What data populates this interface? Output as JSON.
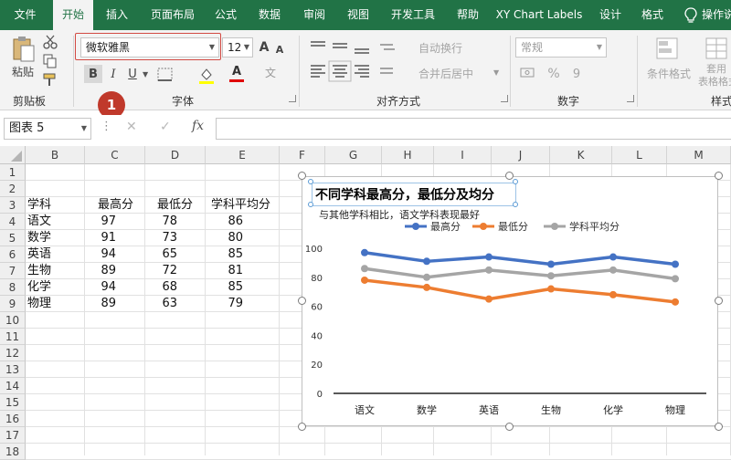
{
  "tabs": [
    "文件",
    "开始",
    "插入",
    "页面布局",
    "公式",
    "数据",
    "审阅",
    "视图",
    "开发工具",
    "帮助",
    "XY Chart Labels",
    "设计",
    "格式",
    "操作说"
  ],
  "ribbon": {
    "paste": "粘贴",
    "font_name": "微软雅黑",
    "font_size": "12",
    "bold": "B",
    "italic": "I",
    "underline": "U",
    "grow_font": "A",
    "shrink_font": "A",
    "font_color_glyph": "A",
    "wen_glyph": "文",
    "wrap_text": "自动换行",
    "merge_center": "合并后居中",
    "number_format": "常规",
    "percent": "%",
    "comma": "9",
    "cond_format": "条件格式",
    "table_format": "套用\n表格格式",
    "groups": {
      "clipboard": "剪贴板",
      "font": "字体",
      "align": "对齐方式",
      "number": "数字",
      "style": "样式"
    },
    "callout_number": "1"
  },
  "formula_bar": {
    "name_box": "图表 5",
    "dots": "⋮",
    "cancel": "✕",
    "enter": "✓",
    "fx": "fx",
    "value": ""
  },
  "sheet": {
    "columns": [
      "B",
      "C",
      "D",
      "E",
      "F",
      "G",
      "H",
      "I",
      "J",
      "K",
      "L",
      "M"
    ],
    "rows": [
      "1",
      "2",
      "3",
      "4",
      "5",
      "6",
      "7",
      "8",
      "9",
      "10",
      "11",
      "12",
      "13",
      "14",
      "15",
      "16",
      "17",
      "18"
    ],
    "header": [
      "学科",
      "最高分",
      "最低分",
      "学科平均分"
    ],
    "data": [
      [
        "语文",
        "97",
        "78",
        "86"
      ],
      [
        "数学",
        "91",
        "73",
        "80"
      ],
      [
        "英语",
        "94",
        "65",
        "85"
      ],
      [
        "生物",
        "89",
        "72",
        "81"
      ],
      [
        "化学",
        "94",
        "68",
        "85"
      ],
      [
        "物理",
        "89",
        "63",
        "79"
      ]
    ]
  },
  "chart_data": {
    "type": "line",
    "title": "不同学科最高分，最低分及均分",
    "subtitle": "与其他学科相比，语文学科表现最好",
    "categories": [
      "语文",
      "数学",
      "英语",
      "生物",
      "化学",
      "物理"
    ],
    "series": [
      {
        "name": "最高分",
        "color": "#4472c4",
        "values": [
          97,
          91,
          94,
          89,
          94,
          89
        ]
      },
      {
        "name": "最低分",
        "color": "#ed7d31",
        "values": [
          78,
          73,
          65,
          72,
          68,
          63
        ]
      },
      {
        "name": "学科平均分",
        "color": "#a5a5a5",
        "values": [
          86,
          80,
          85,
          81,
          85,
          79
        ]
      }
    ],
    "yticks": [
      "0",
      "20",
      "40",
      "60",
      "80",
      "100"
    ],
    "ylim": [
      0,
      100
    ],
    "legend_position": "top",
    "grid": false
  }
}
